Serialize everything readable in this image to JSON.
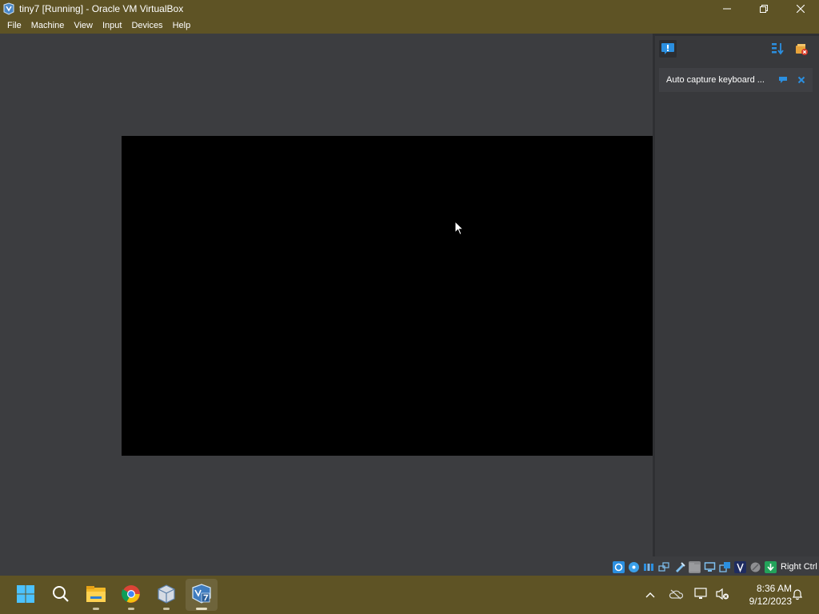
{
  "window": {
    "title": "tiny7 [Running] - Oracle VM VirtualBox",
    "minimize": "—",
    "restore": "❐",
    "close": "✕"
  },
  "menu": [
    "File",
    "Machine",
    "View",
    "Input",
    "Devices",
    "Help"
  ],
  "notification_center": {
    "item_text": "Auto capture keyboard ..."
  },
  "statusbar": {
    "host_key_label": "Right Ctrl",
    "icons": [
      "hard-disk-icon",
      "optical-drive-icon",
      "audio-icon",
      "network-icon",
      "usb-icon",
      "shared-folders-icon",
      "display-icon",
      "video-capture-icon",
      "vt-x-icon",
      "mouse-integration-icon",
      "keyboard-capture-icon"
    ]
  },
  "taskbar": {
    "apps": [
      "start-icon",
      "search-icon",
      "file-explorer-icon",
      "chrome-icon",
      "virtualbox-manager-icon",
      "virtualbox-vm-icon"
    ],
    "time": "8:36 AM",
    "date": "9/12/2023"
  },
  "colors": {
    "titlebar": "#5e5325",
    "background": "#3c3d40",
    "vm_screen": "#000000",
    "accent_blue": "#2b8fe0"
  }
}
